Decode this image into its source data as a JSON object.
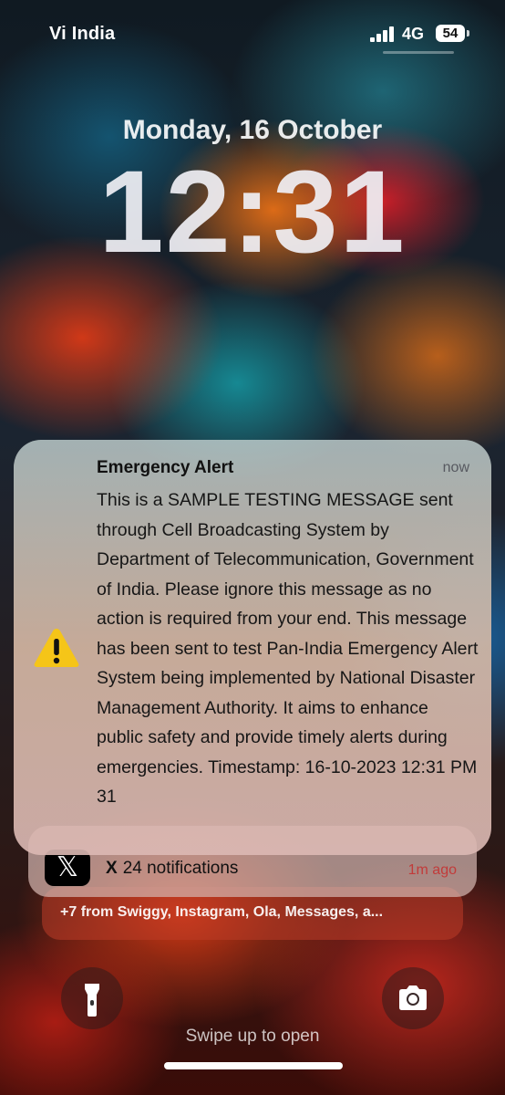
{
  "status_bar": {
    "carrier": "Vi India",
    "network": "4G",
    "battery": "54",
    "icons": [
      "signal-icon",
      "battery-icon"
    ]
  },
  "lock_screen": {
    "date": "Monday, 16 October",
    "time": "12:31"
  },
  "alert": {
    "icon": "warning-icon",
    "title": "Emergency Alert",
    "time": "now",
    "body": "This is a SAMPLE TESTING MESSAGE sent through Cell Broadcasting System by Department of Telecommunication, Government of India. Please ignore this message as no action is required from your end. This message has been sent to test Pan-India Emergency Alert System being implemented by National Disaster Management Authority. It aims to enhance public safety and provide timely alerts during emergencies. Timestamp: 16-10-2023 12:31 PM 31"
  },
  "stacked": {
    "app_icon": "x-app-icon",
    "app_name": "X",
    "summary": "24 notifications",
    "time": "1m ago",
    "more": "+7 from Swiggy, Instagram, Ola, Messages, a..."
  },
  "controls": {
    "flashlight_icon": "flashlight-icon",
    "camera_icon": "camera-icon",
    "swipe_hint": "Swipe up to open"
  },
  "colors": {
    "warning": "#f5c518",
    "x_time": "#c83232"
  }
}
